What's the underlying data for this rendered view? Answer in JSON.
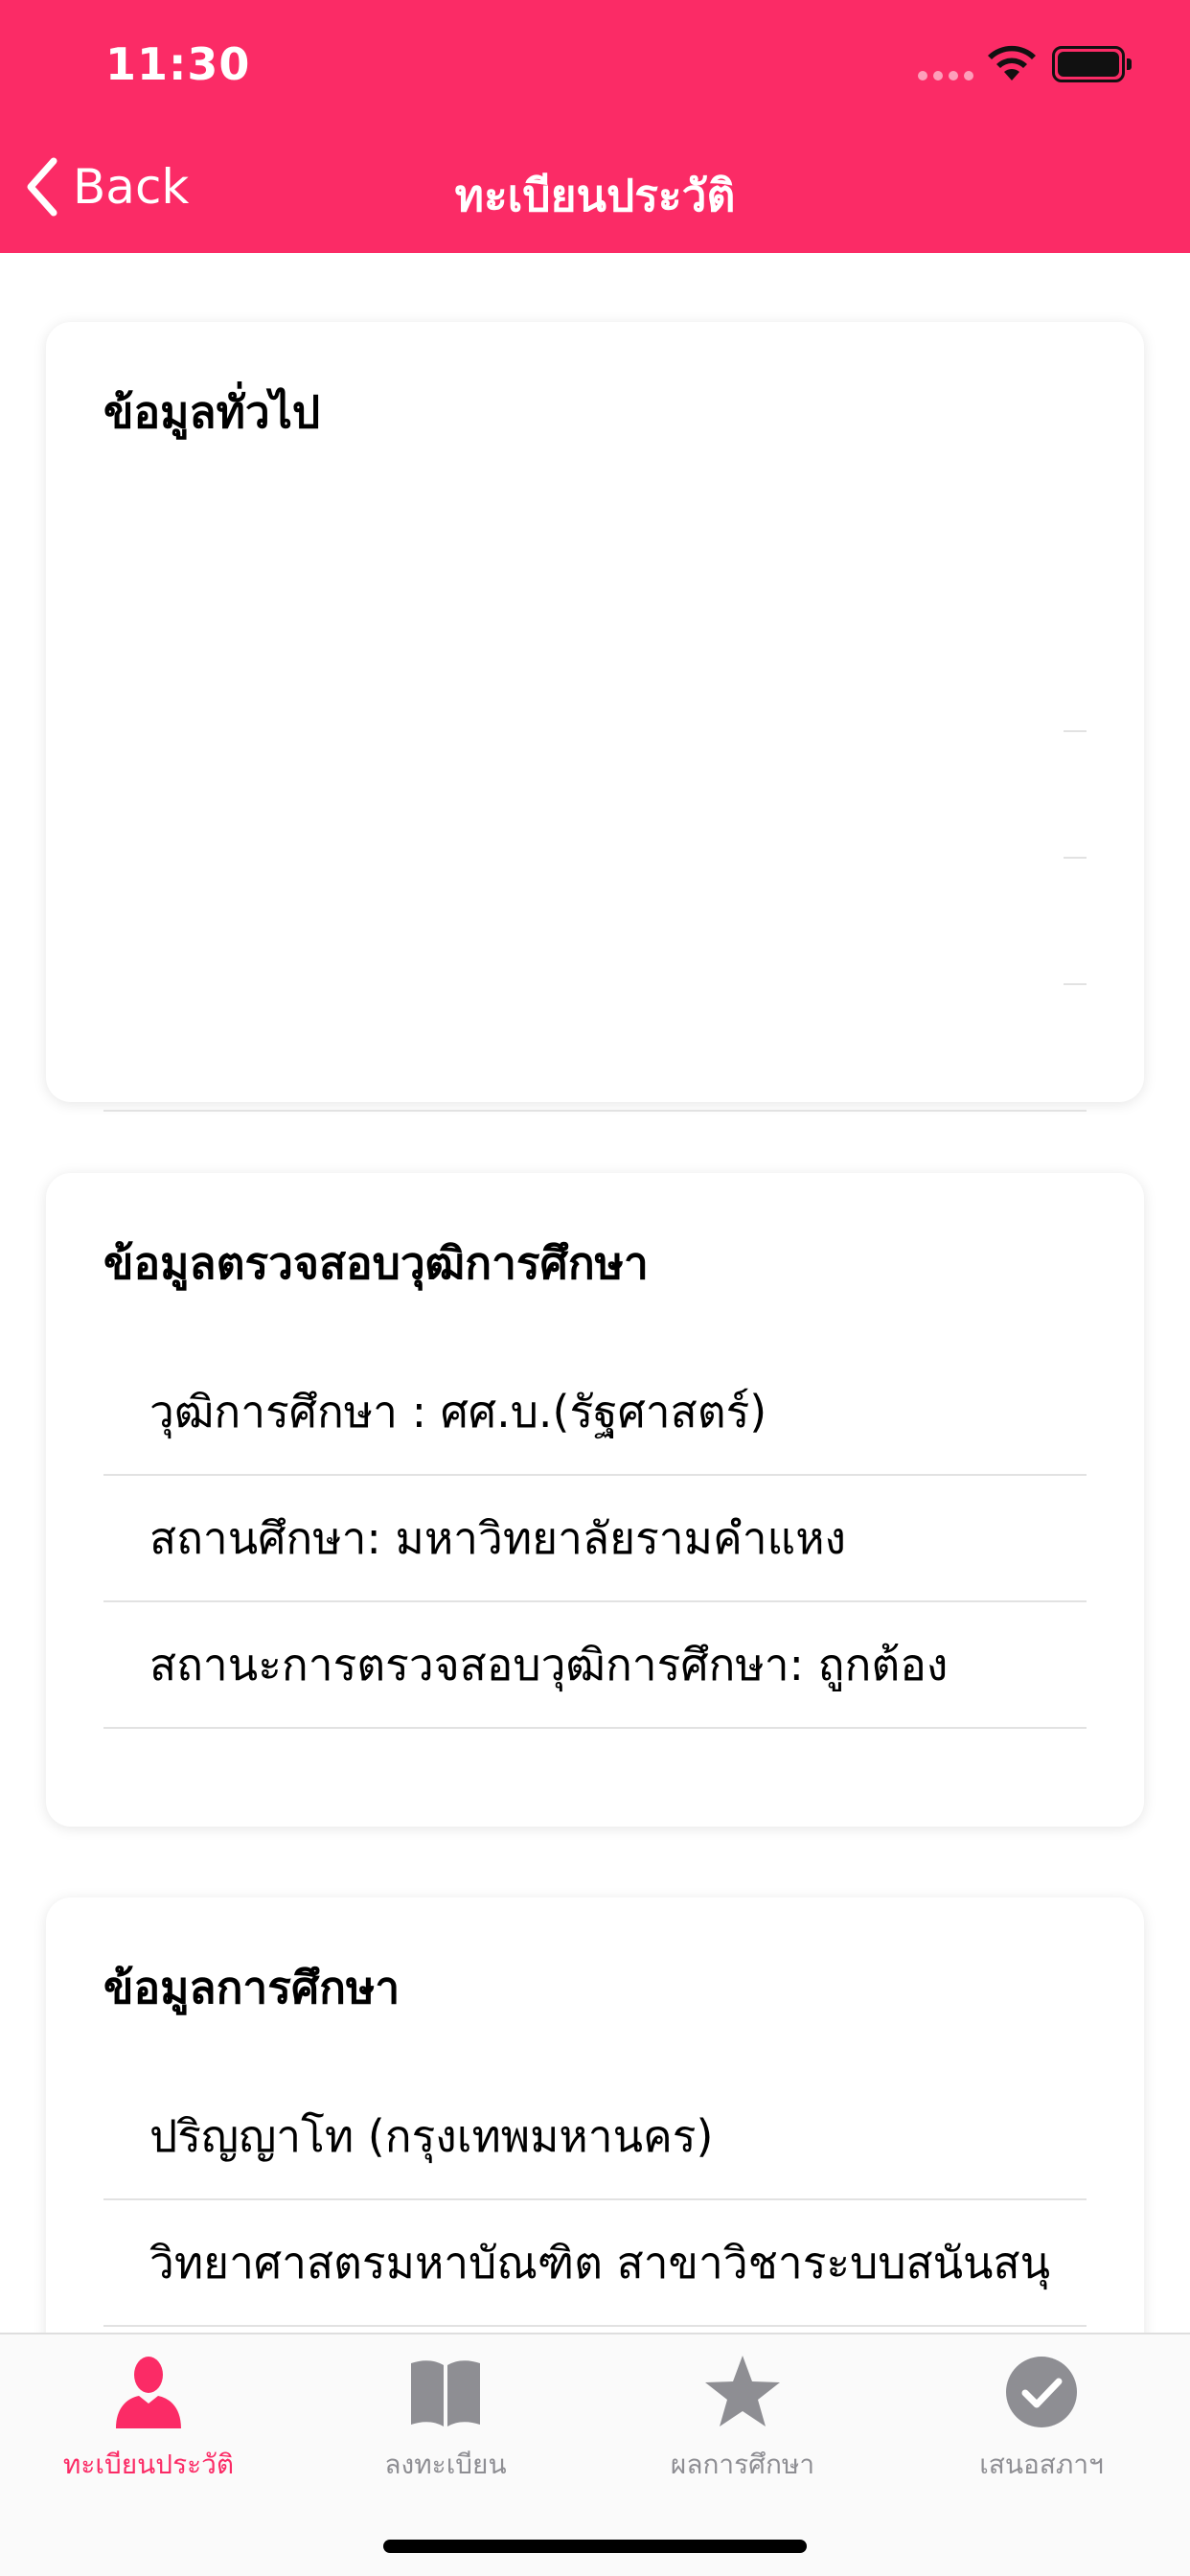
{
  "status_bar": {
    "time": "11:30"
  },
  "nav": {
    "back_label": "Back",
    "title": "ทะเบียนประวัติ"
  },
  "cards": {
    "general": {
      "title": "ข้อมูลทั่วไป"
    },
    "verification": {
      "title": "ข้อมูลตรวจสอบวุฒิการศึกษา",
      "rows": [
        "วุฒิการศึกษา : ศศ.บ.(รัฐศาสตร์)",
        "สถานศึกษา: มหาวิทยาลัยรามคำแหง",
        "สถานะการตรวจสอบวุฒิการศึกษา: ถูกต้อง"
      ]
    },
    "education": {
      "title": "ข้อมูลการศึกษา",
      "rows": [
        "ปริญญาโท (กรุงเทพมหานคร)",
        "วิทยาศาสตรมหาบัณฑิต สาขาวิชาระบบสนันสนุ"
      ]
    }
  },
  "tabs": [
    {
      "label": "ทะเบียนประวัติ",
      "icon": "person-icon",
      "active": true
    },
    {
      "label": "ลงทะเบียน",
      "icon": "book-icon",
      "active": false
    },
    {
      "label": "ผลการศึกษา",
      "icon": "star-icon",
      "active": false
    },
    {
      "label": "เสนอสภาฯ",
      "icon": "checkmark-circle-icon",
      "active": false
    }
  ],
  "colors": {
    "accent": "#fb2b66",
    "tab_inactive": "#8e8e93"
  }
}
